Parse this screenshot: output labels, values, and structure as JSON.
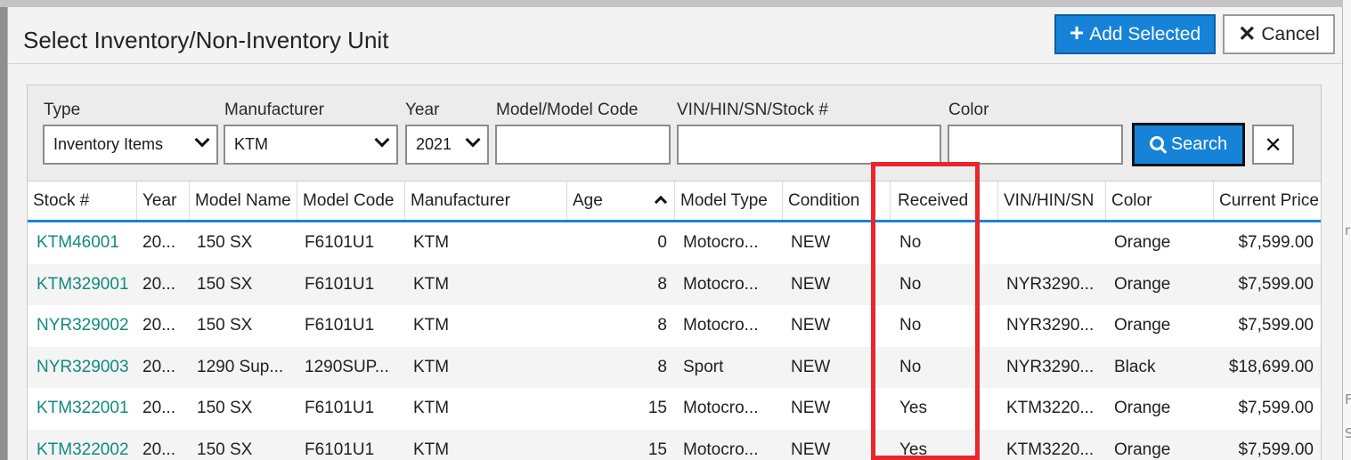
{
  "dialog": {
    "title": "Select Inventory/Non-Inventory Unit",
    "add_label": "Add Selected",
    "cancel_label": "Cancel"
  },
  "filters": {
    "type_label": "Type",
    "type_value": "Inventory Items",
    "manufacturer_label": "Manufacturer",
    "manufacturer_value": "KTM",
    "year_label": "Year",
    "year_value": "2021",
    "model_label": "Model/Model Code",
    "vin_label": "VIN/HIN/SN/Stock #",
    "color_label": "Color",
    "search_label": "Search"
  },
  "columns": [
    "Stock #",
    "Year",
    "Model Name",
    "Model Code",
    "Manufacturer",
    "Age",
    "Model Type",
    "Condition",
    "Received",
    "VIN/HIN/SN",
    "Color",
    "Current Price"
  ],
  "rows": [
    {
      "stock": "KTM46001",
      "year": "20...",
      "model_name": "150 SX",
      "model_code": "F6101U1",
      "manufacturer": "KTM",
      "age": "0",
      "model_type": "Motocro...",
      "condition": "NEW",
      "received": "No",
      "vin": "",
      "color": "Orange",
      "price": "$7,599.00"
    },
    {
      "stock": "KTM329001",
      "year": "20...",
      "model_name": "150 SX",
      "model_code": "F6101U1",
      "manufacturer": "KTM",
      "age": "8",
      "model_type": "Motocro...",
      "condition": "NEW",
      "received": "No",
      "vin": "NYR3290...",
      "color": "Orange",
      "price": "$7,599.00"
    },
    {
      "stock": "NYR329002",
      "year": "20...",
      "model_name": "150 SX",
      "model_code": "F6101U1",
      "manufacturer": "KTM",
      "age": "8",
      "model_type": "Motocro...",
      "condition": "NEW",
      "received": "No",
      "vin": "NYR3290...",
      "color": "Orange",
      "price": "$7,599.00"
    },
    {
      "stock": "NYR329003",
      "year": "20...",
      "model_name": "1290 Sup...",
      "model_code": "1290SUP...",
      "manufacturer": "KTM",
      "age": "8",
      "model_type": "Sport",
      "condition": "NEW",
      "received": "No",
      "vin": "NYR3290...",
      "color": "Black",
      "price": "$18,699.00"
    },
    {
      "stock": "KTM322001",
      "year": "20...",
      "model_name": "150 SX",
      "model_code": "F6101U1",
      "manufacturer": "KTM",
      "age": "15",
      "model_type": "Motocro...",
      "condition": "NEW",
      "received": "Yes",
      "vin": "KTM3220...",
      "color": "Orange",
      "price": "$7,599.00"
    },
    {
      "stock": "KTM322002",
      "year": "20...",
      "model_name": "150 SX",
      "model_code": "F6101U1",
      "manufacturer": "KTM",
      "age": "15",
      "model_type": "Motocro...",
      "condition": "NEW",
      "received": "Yes",
      "vin": "KTM3220...",
      "color": "Orange",
      "price": "$7,599.00"
    }
  ],
  "background_fragments": [
    "ri",
    "F",
    "S"
  ],
  "colors": {
    "accent": "#1683d9",
    "link": "#118a7e",
    "highlight": "#e8262d"
  }
}
